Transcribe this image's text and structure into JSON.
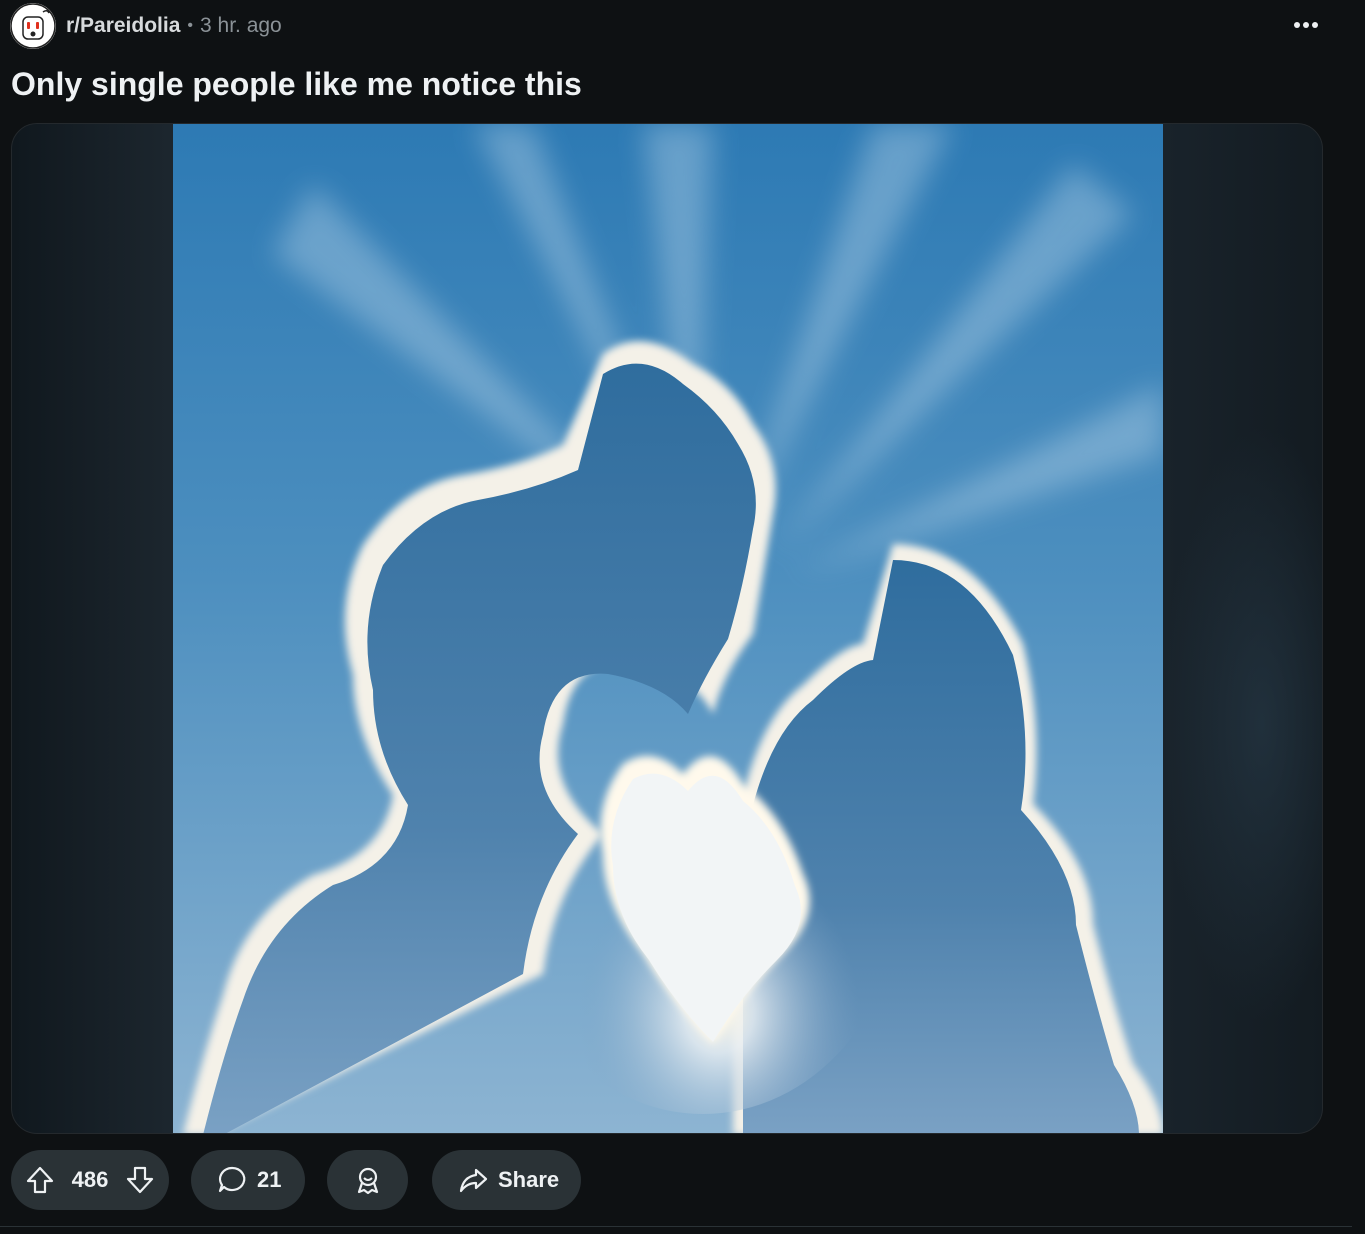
{
  "post": {
    "subreddit": "r/Pareidolia",
    "separator": "•",
    "time": "3 hr. ago",
    "title": "Only single people like me notice this",
    "more_icon": "more-horizontal-icon"
  },
  "media": {
    "description_icon": "image"
  },
  "actions": {
    "upvote_icon": "upvote-arrow-icon",
    "score": "486",
    "downvote_icon": "downvote-arrow-icon",
    "comment_icon": "comment-bubble-icon",
    "comments": "21",
    "award_icon": "award-icon",
    "share_icon": "share-arrow-icon",
    "share_label": "Share"
  },
  "colors": {
    "background": "#0e1113",
    "pill": "#2a3236",
    "text": "#eef1f3",
    "muted": "#8b9297"
  }
}
